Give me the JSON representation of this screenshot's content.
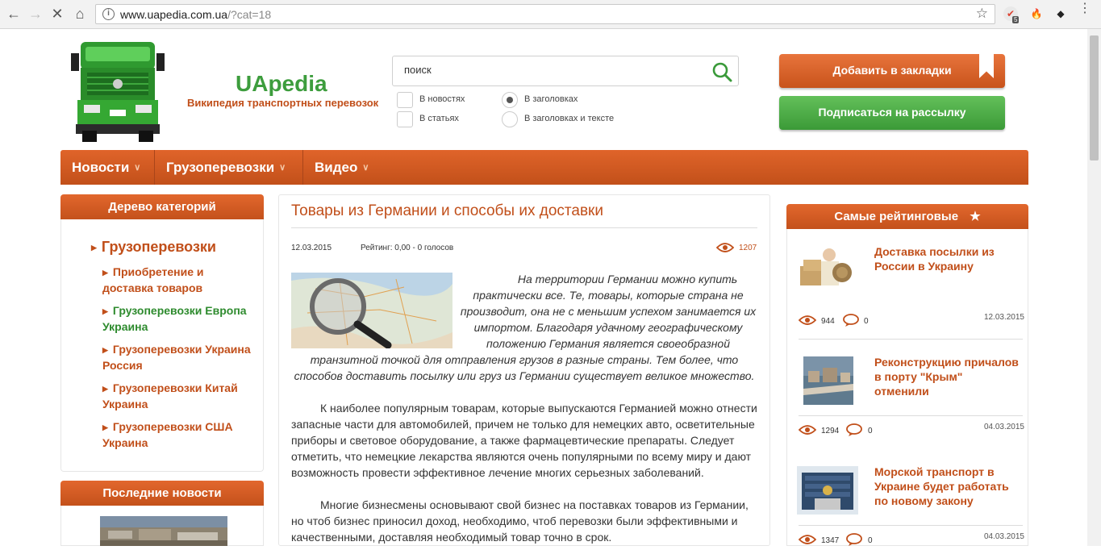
{
  "browser": {
    "url_host": "www.uapedia.com.ua",
    "url_path": "/?cat=18",
    "ext_badge": "5"
  },
  "header": {
    "brand": "UApedia",
    "tagline": "Википедия транспортных перевозок",
    "search_value": "поиск",
    "search_options": {
      "in_news": "В новостях",
      "in_articles": "В статьях",
      "in_titles": "В заголовках",
      "in_titles_text": "В заголовках и тексте"
    },
    "bookmark_button": "Добавить в закладки",
    "subscribe_button": "Подписаться на рассылку"
  },
  "mainnav": {
    "items": [
      "Новости",
      "Грузоперевозки",
      "Видео"
    ],
    "caret": "∨"
  },
  "left": {
    "tree_title": "Дерево категорий",
    "main_category": "Грузоперевозки",
    "subcategories": [
      "Приобретение и доставка товаров",
      "Грузоперевозки Европа Украина",
      "Грузоперевозки Украина Россия",
      "Грузоперевозки Китай Украина",
      "Грузоперевозки США Украина"
    ],
    "latest_title": "Последние новости"
  },
  "article": {
    "title": "Товары из Германии и способы их доставки",
    "date": "12.03.2015",
    "rating": "Рейтинг: 0,00 - 0 голосов",
    "views": "1207",
    "lead": "На территории Германии можно купить практически все. Те, товары, которые страна не производит, она не с меньшим успехом занимается их импортом. Благодаря удачному географическому положению Германия является своеобразной транзитной точкой для отправления грузов в разные страны. Тем более, что способов доставить посылку или груз из Германии существует великое множество.",
    "p1": "К наиболее популярным товарам, которые выпускаются Германией можно отнести запасные части для автомобилей, причем не только для немецких авто, осветительные приборы и световое оборудование, а также фармацевтические препараты. Следует отметить, что немецкие лекарства являются очень популярными по всему миру и дают возможность провести эффективное лечение многих серьезных заболеваний.",
    "p2": "Многие бизнесмены основывают свой бизнес на поставках товаров из Германии, но чтоб бизнес приносил доход, необходимо, чтоб перевозки были эффективными и качественными, доставляя необходимый товар точно в срок."
  },
  "right": {
    "title": "Самые рейтинговые",
    "items": [
      {
        "title": "Доставка посылки из России в Украину",
        "views": "944",
        "comments": "0",
        "date": "12.03.2015"
      },
      {
        "title": "Реконструкцию причалов в порту \"Крым\" отменили",
        "views": "1294",
        "comments": "0",
        "date": "04.03.2015"
      },
      {
        "title": "Морской транспорт в Украине будет работать по новому закону",
        "views": "1347",
        "comments": "0",
        "date": "04.03.2015"
      }
    ]
  },
  "colors": {
    "accent_orange": "#c8531b",
    "brand_green": "#3d9d3d",
    "link_green": "#2e8b2e"
  }
}
